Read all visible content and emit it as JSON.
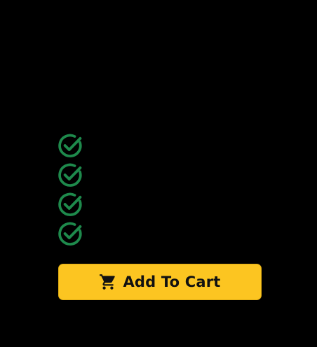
{
  "colors": {
    "background": "#000000",
    "check_green": "#1E8A4C",
    "button_fill": "#FCC521",
    "button_text": "#111111"
  },
  "checklist": {
    "icon": "check-circle-icon",
    "item_count": 4
  },
  "cart_button": {
    "label": "Add To Cart",
    "icon": "shopping-cart-icon"
  }
}
